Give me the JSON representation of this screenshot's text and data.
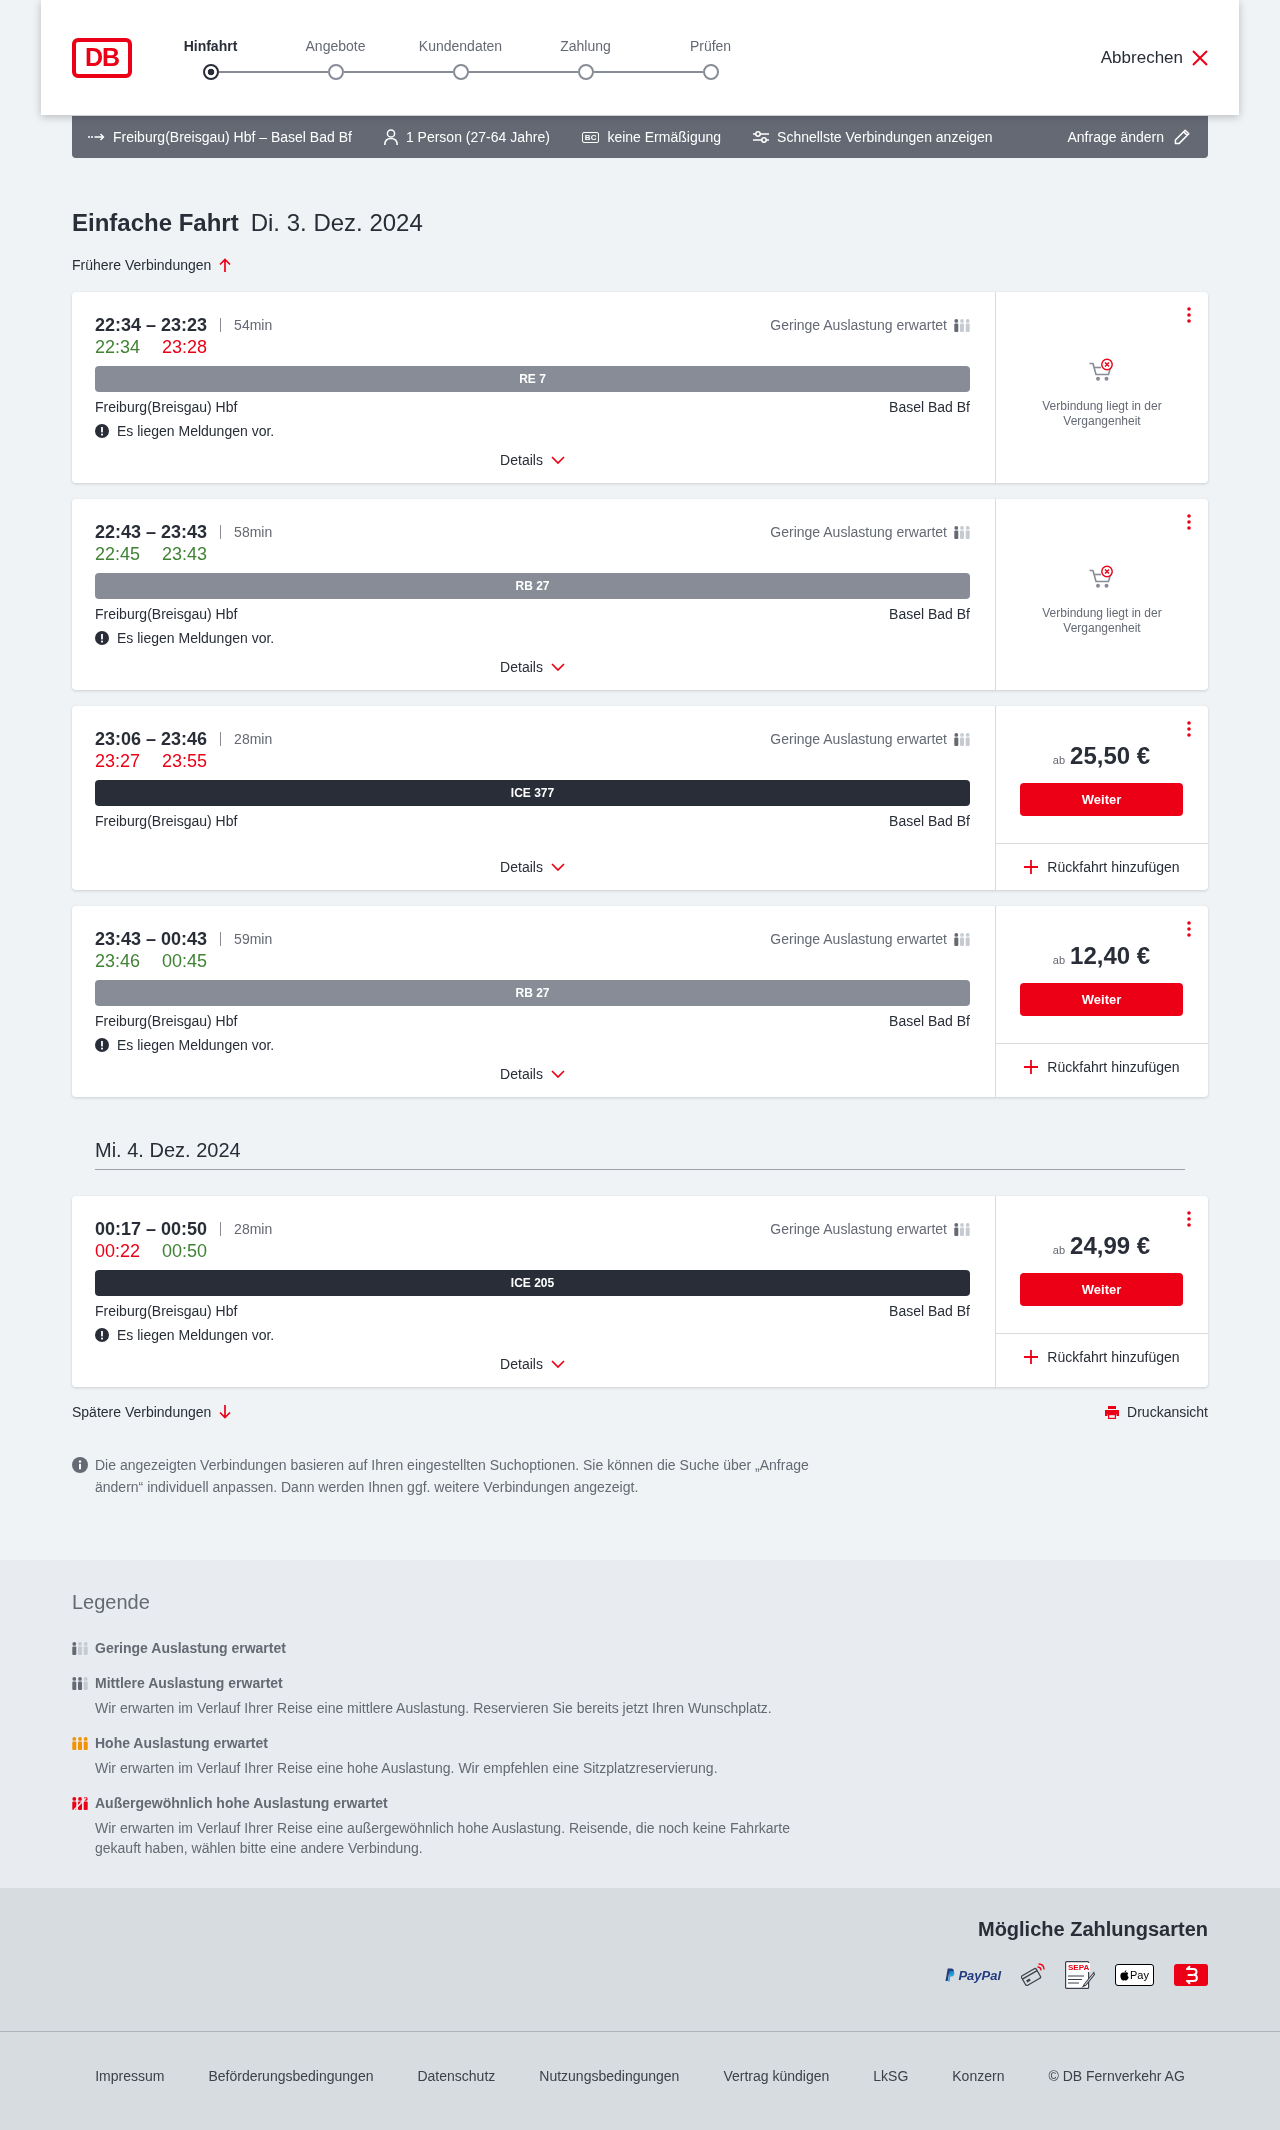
{
  "header": {
    "logo": "DB",
    "steps": [
      {
        "label": "Hinfahrt",
        "selected": true
      },
      {
        "label": "Angebote",
        "selected": false
      },
      {
        "label": "Kundendaten",
        "selected": false
      },
      {
        "label": "Zahlung",
        "selected": false
      },
      {
        "label": "Prüfen",
        "selected": false
      }
    ],
    "cancel": "Abbrechen"
  },
  "query_bar": {
    "items": [
      {
        "kind": "route",
        "text": "Freiburg(Breisgau) Hbf – Basel Bad Bf"
      },
      {
        "kind": "travellers",
        "text": "1 Person (27-64 Jahre)"
      },
      {
        "kind": "discount",
        "badge": "BC",
        "text": "keine Ermäßigung"
      },
      {
        "kind": "options",
        "text": "Schnellste Verbindungen anzeigen"
      }
    ],
    "edit": "Anfrage ändern"
  },
  "heading": {
    "trip_type": "Einfache Fahrt",
    "date": "Di. 3. Dez. 2024"
  },
  "earlier": "Frühere Verbindungen",
  "groups": [
    {
      "connections": [
        {
          "times": "22:34 – 23:23",
          "duration": "54min",
          "realtime": [
            {
              "time": "22:34",
              "late": false
            },
            {
              "time": "23:28",
              "late": true
            }
          ],
          "occupancy": {
            "kind": "low",
            "text": "Geringe Auslastung erwartet"
          },
          "train": {
            "kind": "regional",
            "name": "RE 7"
          },
          "from": "Freiburg(Breisgau) Hbf",
          "to": "Basel Bad Bf",
          "message": "Es liegen Meldungen vor.",
          "details": "Details",
          "offer": {
            "kind": "past",
            "text": "Verbindung liegt in der Vergangenheit"
          }
        },
        {
          "times": "22:43 – 23:43",
          "duration": "58min",
          "realtime": [
            {
              "time": "22:45",
              "late": false
            },
            {
              "time": "23:43",
              "late": false
            }
          ],
          "occupancy": {
            "kind": "low",
            "text": "Geringe Auslastung erwartet"
          },
          "train": {
            "kind": "regional",
            "name": "RB 27"
          },
          "from": "Freiburg(Breisgau) Hbf",
          "to": "Basel Bad Bf",
          "message": "Es liegen Meldungen vor.",
          "details": "Details",
          "offer": {
            "kind": "past",
            "text": "Verbindung liegt in der Vergangenheit"
          }
        },
        {
          "times": "23:06 – 23:46",
          "duration": "28min",
          "realtime": [
            {
              "time": "23:27",
              "late": true
            },
            {
              "time": "23:55",
              "late": true
            }
          ],
          "occupancy": {
            "kind": "low",
            "text": "Geringe Auslastung erwartet"
          },
          "train": {
            "kind": "long_distance",
            "name": "ICE 377"
          },
          "from": "Freiburg(Breisgau) Hbf",
          "to": "Basel Bad Bf",
          "details": "Details",
          "offer": {
            "kind": "price",
            "prefix": "ab",
            "amount": "25,50 €",
            "button": "Weiter",
            "return_trip": "Rückfahrt hinzufügen"
          }
        },
        {
          "times": "23:43 – 00:43",
          "duration": "59min",
          "realtime": [
            {
              "time": "23:46",
              "late": false
            },
            {
              "time": "00:45",
              "late": false
            }
          ],
          "occupancy": {
            "kind": "low",
            "text": "Geringe Auslastung erwartet"
          },
          "train": {
            "kind": "regional",
            "name": "RB 27"
          },
          "from": "Freiburg(Breisgau) Hbf",
          "to": "Basel Bad Bf",
          "message": "Es liegen Meldungen vor.",
          "details": "Details",
          "offer": {
            "kind": "price",
            "prefix": "ab",
            "amount": "12,40 €",
            "button": "Weiter",
            "return_trip": "Rückfahrt hinzufügen"
          }
        }
      ]
    },
    {
      "date": "Mi. 4. Dez. 2024",
      "connections": [
        {
          "times": "00:17 – 00:50",
          "duration": "28min",
          "realtime": [
            {
              "time": "00:22",
              "late": true
            },
            {
              "time": "00:50",
              "late": false
            }
          ],
          "occupancy": {
            "kind": "low",
            "text": "Geringe Auslastung erwartet"
          },
          "train": {
            "kind": "long_distance",
            "name": "ICE 205"
          },
          "from": "Freiburg(Breisgau) Hbf",
          "to": "Basel Bad Bf",
          "message": "Es liegen Meldungen vor.",
          "details": "Details",
          "offer": {
            "kind": "price",
            "prefix": "ab",
            "amount": "24,99 €",
            "button": "Weiter",
            "return_trip": "Rückfahrt hinzufügen"
          }
        }
      ]
    }
  ],
  "later": "Spätere Verbindungen",
  "print": "Druckansicht",
  "note": "Die angezeigten Verbindungen basieren auf Ihren eingestellten Suchoptionen. Sie können die Suche über „Anfrage ändern“ individuell anpassen. Dann werden Ihnen ggf. weitere Verbindungen angezeigt.",
  "legend": {
    "title": "Legende",
    "items": [
      {
        "kind": "low",
        "title": "Geringe Auslastung erwartet"
      },
      {
        "kind": "medium",
        "title": "Mittlere Auslastung erwartet",
        "text": "Wir erwarten im Verlauf Ihrer Reise eine mittlere Auslastung. Reservieren Sie bereits jetzt Ihren Wunschplatz."
      },
      {
        "kind": "high",
        "title": "Hohe Auslastung erwartet",
        "text": "Wir erwarten im Verlauf Ihrer Reise eine hohe Auslastung. Wir empfehlen eine Sitzplatzreservierung."
      },
      {
        "kind": "exceptional",
        "title": "Außergewöhnlich hohe Auslastung erwartet",
        "text": "Wir erwarten im Verlauf Ihrer Reise eine außergewöhnlich hohe Auslastung. Reisende, die noch keine Fahrkarte gekauft haben, wählen bitte eine andere Verbindung."
      }
    ]
  },
  "payment": {
    "title": "Mögliche Zahlungsarten",
    "methods": [
      {
        "kind": "paypal",
        "label": "PayPal"
      },
      {
        "kind": "contactless"
      },
      {
        "kind": "sepa",
        "label": "SEPA"
      },
      {
        "kind": "applepay",
        "label": "Pay"
      },
      {
        "kind": "db"
      }
    ]
  },
  "footer": {
    "links": [
      "Impressum",
      "Beförderungsbedingungen",
      "Datenschutz",
      "Nutzungsbedingungen",
      "Vertrag kündigen",
      "LkSG",
      "Konzern"
    ],
    "copyright": "© DB Fernverkehr AG"
  }
}
